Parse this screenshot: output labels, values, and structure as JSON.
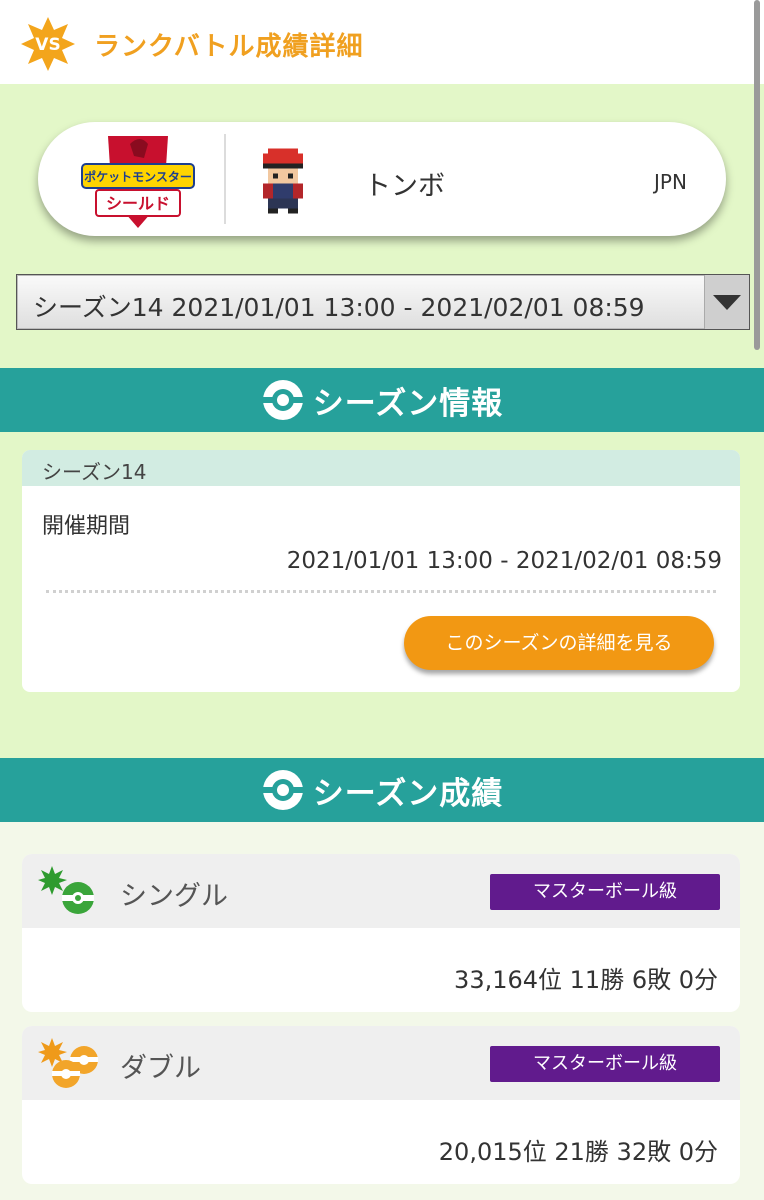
{
  "header": {
    "badge_text": "VS",
    "title": "ランクバトル成績詳細"
  },
  "profile": {
    "game_logo": "ポケットモンスター シールド",
    "game_logo_lines": [
      "ポケットモンスター",
      "シールド"
    ],
    "trainer_name": "トンボ",
    "region": "JPN"
  },
  "season_select": {
    "selected": "シーズン14 2021/01/01 13:00 - 2021/02/01 08:59"
  },
  "season_info": {
    "section_title": "シーズン情報",
    "season_name": "シーズン14",
    "period_label": "開催期間",
    "period_value": "2021/01/01 13:00 - 2021/02/01 08:59",
    "detail_button": "このシーズンの詳細を見る"
  },
  "season_results": {
    "section_title": "シーズン成績",
    "entries": [
      {
        "label": "シングル",
        "rank_class": "マスターボール級",
        "stats": "33,164位 11勝 6敗 0分",
        "icon": "single-battle-icon"
      },
      {
        "label": "ダブル",
        "rank_class": "マスターボール級",
        "stats": "20,015位 21勝 32敗 0分",
        "icon": "double-battle-icon"
      }
    ]
  },
  "colors": {
    "accent_orange": "#f29813",
    "teal": "#26a19b",
    "master_purple": "#611b8d",
    "background_green": "#e3f7c8"
  }
}
